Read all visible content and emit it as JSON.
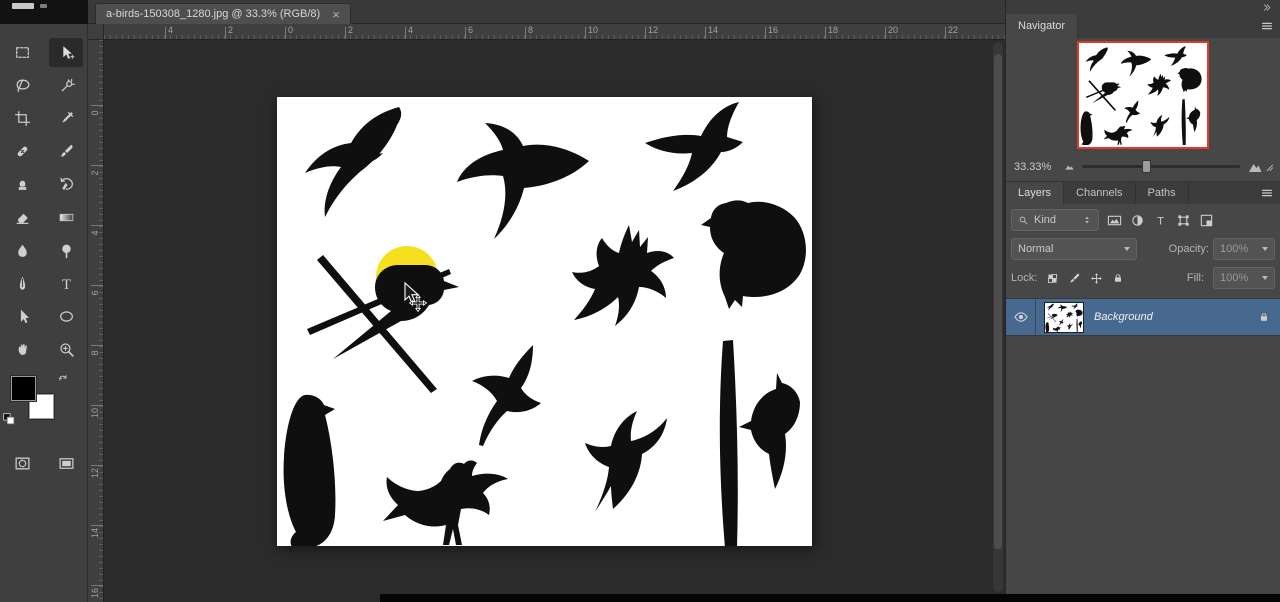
{
  "window": {
    "tab_title": "a-birds-150308_1280.jpg @ 33.3% (RGB/8)",
    "close_label": "×"
  },
  "toolbar": {
    "selected_tool": "move",
    "tools": [
      "rectangular-marquee",
      "move",
      "lasso",
      "quick-selection",
      "crop",
      "eyedropper",
      "healing-brush",
      "brush",
      "clone-stamp",
      "history-brush",
      "eraser",
      "gradient",
      "blur",
      "dodge",
      "pen",
      "type",
      "path-selection",
      "ellipse-shape",
      "hand",
      "zoom"
    ],
    "extras": [
      "quick-mask",
      "screen-mode"
    ],
    "foreground_color": "#000000",
    "background_color": "#ffffff"
  },
  "rulers": {
    "horizontal_labels": [
      "4",
      "2",
      "0",
      "2",
      "4",
      "6",
      "8",
      "10",
      "12",
      "14",
      "16",
      "18",
      "20",
      "22"
    ],
    "vertical_labels": [
      "0",
      "2",
      "4",
      "6",
      "8",
      "10",
      "12",
      "14",
      "16"
    ]
  },
  "navigator": {
    "title": "Navigator",
    "zoom_value": "33.33%"
  },
  "layers": {
    "tabs": [
      "Layers",
      "Channels",
      "Paths"
    ],
    "active_tab": "Layers",
    "kind_filter_label": "Kind",
    "blend_mode": "Normal",
    "opacity_label": "Opacity:",
    "opacity_value": "100%",
    "lock_label": "Lock:",
    "fill_label": "Fill:",
    "fill_value": "100%",
    "items": [
      {
        "name": "Background",
        "visible": true,
        "locked": true,
        "selected": true
      }
    ]
  },
  "canvas": {
    "highlight_color": "#f4dd13",
    "selection_color": "#47698f",
    "navigator_frame_color": "#e2392b"
  }
}
